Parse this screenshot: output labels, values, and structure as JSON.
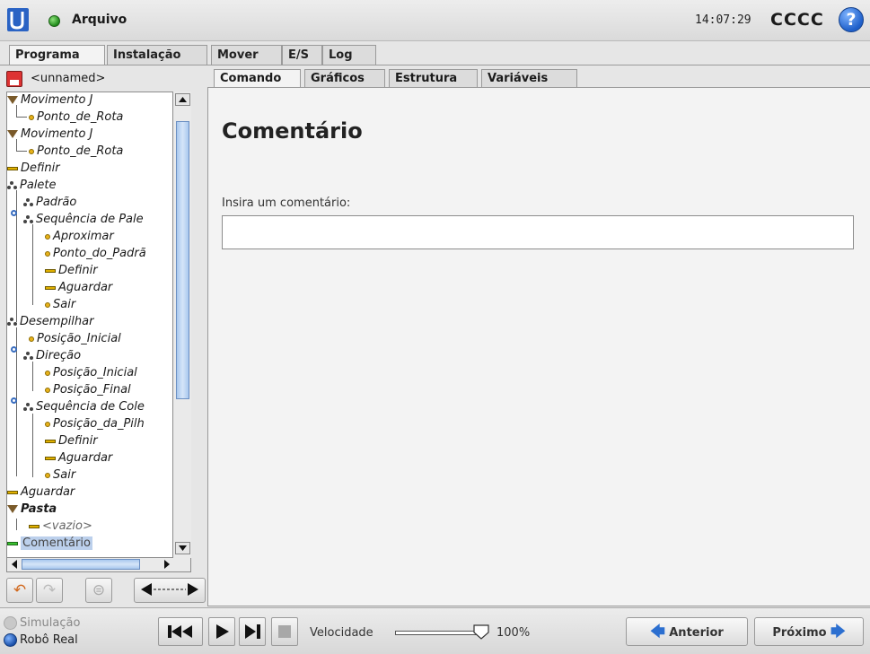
{
  "header": {
    "file_menu": "Arquivo",
    "clock": "14:07:29",
    "robot_name": "CCCC",
    "help": "?"
  },
  "main_tabs": [
    "Programa",
    "Instalação",
    "Mover",
    "E/S",
    "Log"
  ],
  "left": {
    "program_name": "<unnamed>",
    "tree": [
      {
        "label": "Movimento J",
        "icon": "move-icon"
      },
      {
        "label": "Ponto_de_Rota",
        "icon": "waypoint-icon"
      },
      {
        "label": "Movimento J",
        "icon": "move-icon"
      },
      {
        "label": "Ponto_de_Rota",
        "icon": "waypoint-icon"
      },
      {
        "label": "Definir",
        "icon": "set-icon"
      },
      {
        "label": "Palete",
        "icon": "pallet-icon"
      },
      {
        "label": "Padrão",
        "icon": "pallet-icon"
      },
      {
        "label": "Sequência de Pale",
        "icon": "pallet-icon"
      },
      {
        "label": "Aproximar",
        "icon": "waypoint-icon"
      },
      {
        "label": "Ponto_do_Padrã",
        "icon": "waypoint-icon"
      },
      {
        "label": "Definir",
        "icon": "set-icon"
      },
      {
        "label": "Aguardar",
        "icon": "wait-icon"
      },
      {
        "label": "Sair",
        "icon": "waypoint-icon"
      },
      {
        "label": "Desempilhar",
        "icon": "pallet-icon"
      },
      {
        "label": "Posição_Inicial",
        "icon": "waypoint-icon"
      },
      {
        "label": "Direção",
        "icon": "pallet-icon"
      },
      {
        "label": "Posição_Inicial",
        "icon": "waypoint-icon"
      },
      {
        "label": "Posição_Final",
        "icon": "waypoint-icon"
      },
      {
        "label": "Sequência de Cole",
        "icon": "pallet-icon"
      },
      {
        "label": "Posição_da_Pilh",
        "icon": "waypoint-icon"
      },
      {
        "label": "Definir",
        "icon": "set-icon"
      },
      {
        "label": "Aguardar",
        "icon": "wait-icon"
      },
      {
        "label": "Sair",
        "icon": "waypoint-icon"
      },
      {
        "label": "Aguardar",
        "icon": "wait-icon"
      },
      {
        "label": "Pasta",
        "icon": "folder-icon"
      },
      {
        "label": "<vazio>",
        "icon": "empty-icon"
      },
      {
        "label": "Comentário",
        "icon": "comment-icon"
      }
    ]
  },
  "sub_tabs": [
    "Comando",
    "Gráficos",
    "Estrutura",
    "Variáveis"
  ],
  "content": {
    "title": "Comentário",
    "comment_label": "Insira um comentário:",
    "comment_value": ""
  },
  "bottom": {
    "mode_sim": "Simulação",
    "mode_real": "Robô Real",
    "speed_label": "Velocidade",
    "speed_value": "100%",
    "speed_fraction": 1.0,
    "prev": "Anterior",
    "next": "Próximo"
  },
  "colors": {
    "accent": "#2c6fd0",
    "selection": "#bcd0ec",
    "status_green": "#1f8a1a"
  }
}
